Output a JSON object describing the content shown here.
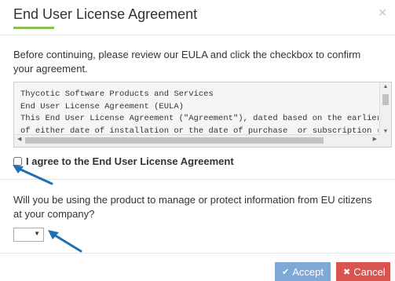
{
  "dialog": {
    "title": "End User License Agreement",
    "close_icon": "close-icon",
    "intro": "Before continuing, please review our EULA and click the checkbox to confirm your agreement.",
    "eula_lines": [
      "Thycotic Software Products and Services",
      "End User License Agreement (EULA)",
      "This End User License Agreement (\"Agreement\"), dated based on the earlier",
      "of either date of installation or the date of purchase  or subscription (t"
    ],
    "agree_label": "I agree to the End User License Agreement",
    "agree_checked": false,
    "question": "Will you be using the product to manage or protect information from EU citizens at your company?",
    "select_value": "",
    "accept_label": "Accept",
    "accept_icon": "check-icon",
    "cancel_label": "Cancel",
    "cancel_icon": "x-icon"
  },
  "colors": {
    "accent_underline": "#8cc152",
    "accept": "#7fa8d6",
    "cancel": "#d9534f",
    "arrow": "#1f6fb5"
  }
}
